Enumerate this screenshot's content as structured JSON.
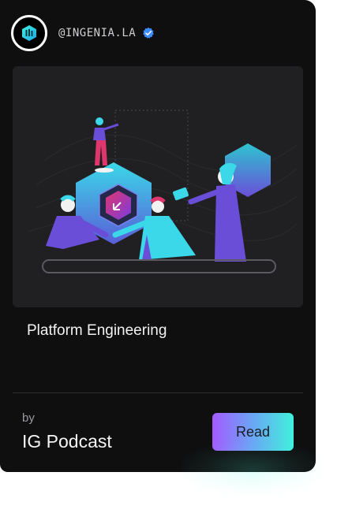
{
  "profile": {
    "handle": "@INGENIA.LA",
    "verified_icon": "verified-badge-icon",
    "logo_icon": "ingenia-logo-icon"
  },
  "post": {
    "illustration_icon": "team-collaboration-illustration",
    "title": "Platform Engineering"
  },
  "footer": {
    "by_label": "by",
    "author": "IG Podcast",
    "read_label": "Read"
  },
  "colors": {
    "card_bg": "#0f0f10",
    "media_bg": "#202022",
    "accent_purple": "#a45bff",
    "accent_teal": "#3ff2dc",
    "verified_blue": "#3d8cff"
  }
}
